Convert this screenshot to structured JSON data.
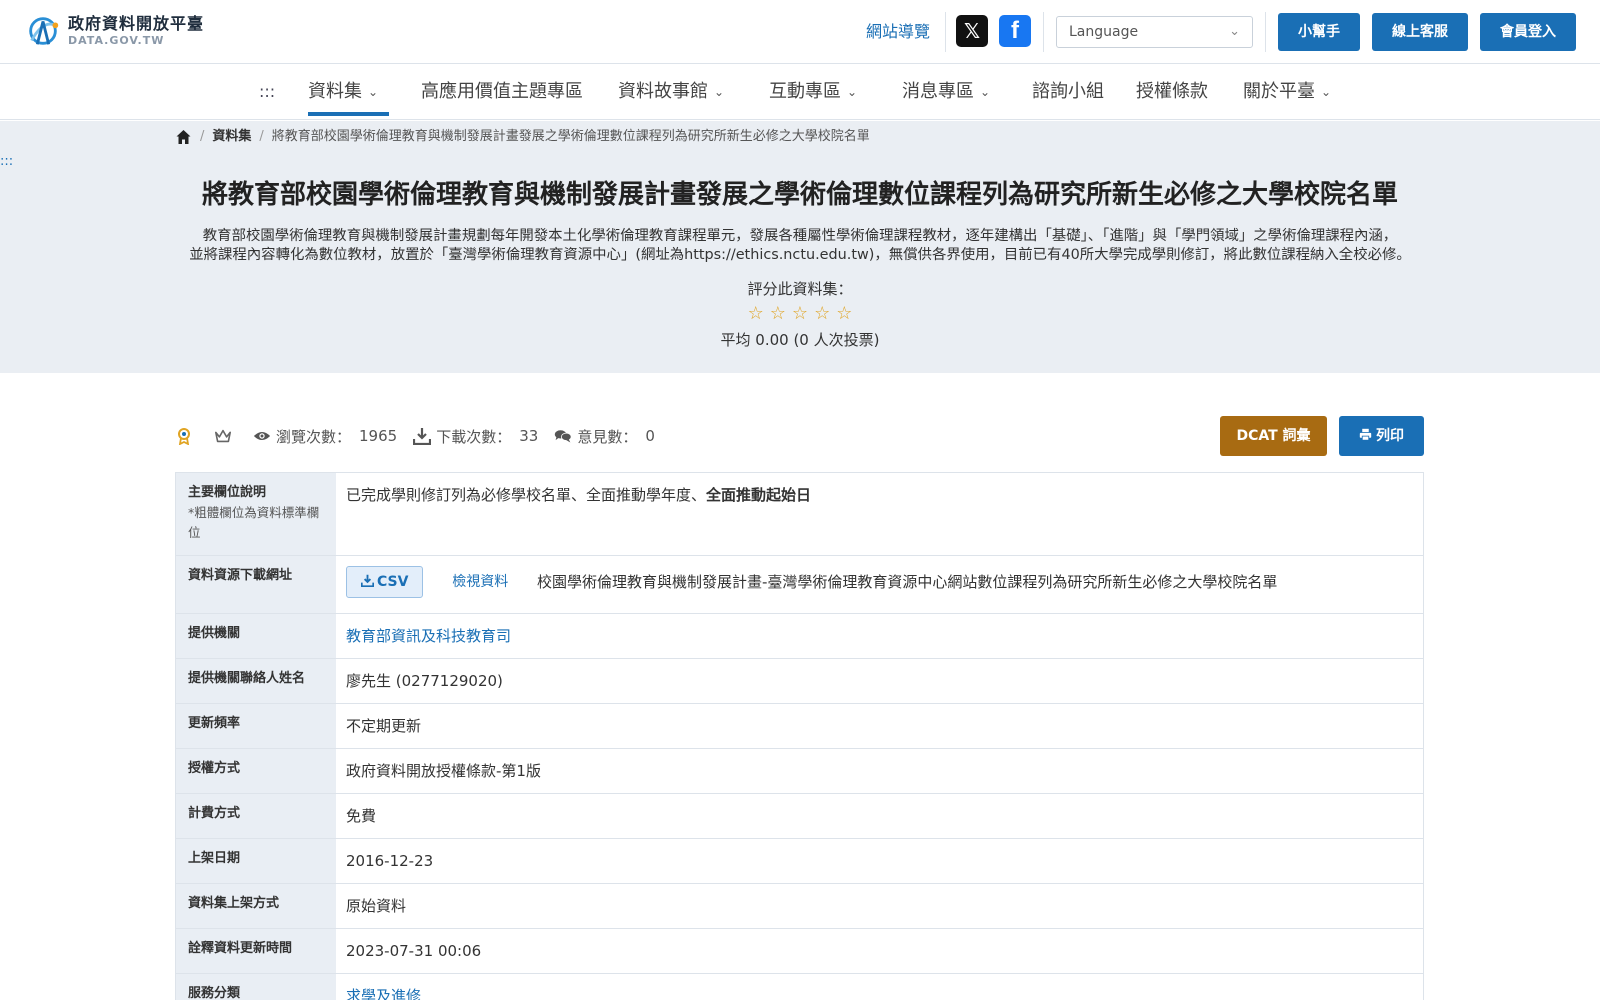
{
  "header": {
    "logo_title": "政府資料開放平臺",
    "logo_sub": "DATA.GOV.TW",
    "sitemap": "網站導覽",
    "x_glyph": "𝕏",
    "fb_glyph": "f",
    "language_placeholder": "Language",
    "help_btn": "小幫手",
    "service_btn": "線上客服",
    "login_btn": "會員登入"
  },
  "nav": {
    "accesskey": ":::",
    "items": [
      {
        "label": "資料集",
        "dropdown": true,
        "active": true
      },
      {
        "label": "高應用價值主題專區",
        "dropdown": false
      },
      {
        "label": "資料故事館",
        "dropdown": true
      },
      {
        "label": "互動專區",
        "dropdown": true
      },
      {
        "label": "消息專區",
        "dropdown": true
      },
      {
        "label": "諮詢小組",
        "dropdown": false
      },
      {
        "label": "授權條款",
        "dropdown": false
      },
      {
        "label": "關於平臺",
        "dropdown": true
      }
    ]
  },
  "breadcrumb": {
    "level1": "資料集",
    "current": "將教育部校園學術倫理教育與機制發展計畫發展之學術倫理數位課程列為研究所新生必修之大學校院名單"
  },
  "hero": {
    "accesskey": ":::",
    "title": "將教育部校園學術倫理教育與機制發展計畫發展之學術倫理數位課程列為研究所新生必修之大學校院名單",
    "desc_line1": "教育部校園學術倫理教育與機制發展計畫規劃每年開發本土化學術倫理教育課程單元，發展各種屬性學術倫理課程教材，逐年建構出「基礎」、「進階」與「學門領域」之學術倫理課程內涵，",
    "desc_line2": "並將課程內容轉化為數位教材，放置於「臺灣學術倫理教育資源中心」(網址為https://ethics.nctu.edu.tw)，無償供各界使用，目前已有40所大學完成學則修訂，將此數位課程納入全校必修。",
    "rate_label": "評分此資料集：",
    "star_glyph": "☆",
    "star_count": 5,
    "rating_avg": "平均 0.00 (0 人次投票)"
  },
  "stats": {
    "views_label": "瀏覽次數：",
    "views": "1965",
    "downloads_label": "下載次數：",
    "downloads": "33",
    "comments_label": "意見數：",
    "comments": "0",
    "dcat_btn": "DCAT 詞彙",
    "print_btn": "列印"
  },
  "meta": {
    "fields_key": "主要欄位說明",
    "fields_note": "*粗體欄位為資料標準欄位",
    "fields_plain": "已完成學則修訂列為必修學校名單、全面推動學年度、",
    "fields_bold": "全面推動起始日",
    "resource_key": "資料資源下載網址",
    "csv_label": "CSV",
    "view_label": "檢視資料",
    "resource_title": "校園學術倫理教育與機制發展計畫-臺灣學術倫理教育資源中心網站數位課程列為研究所新生必修之大學校院名單",
    "rows": [
      {
        "key": "提供機關",
        "value": "教育部資訊及科技教育司",
        "link": true
      },
      {
        "key": "提供機關聯絡人姓名",
        "value": "廖先生 (0277129020)",
        "link": false
      },
      {
        "key": "更新頻率",
        "value": "不定期更新",
        "link": false
      },
      {
        "key": "授權方式",
        "value": "政府資料開放授權條款-第1版",
        "link": false
      },
      {
        "key": "計費方式",
        "value": "免費",
        "link": false
      },
      {
        "key": "上架日期",
        "value": "2016-12-23",
        "link": false
      },
      {
        "key": "資料集上架方式",
        "value": "原始資料",
        "link": false
      },
      {
        "key": "詮釋資料更新時間",
        "value": "2023-07-31 00:06",
        "link": false
      },
      {
        "key": "服務分類",
        "value": "求學及進修",
        "link": true
      }
    ]
  },
  "colors": {
    "primary": "#1a6fb5",
    "dcat": "#a86b12",
    "hero_bg": "#eaeef3",
    "star": "#e0a423"
  }
}
